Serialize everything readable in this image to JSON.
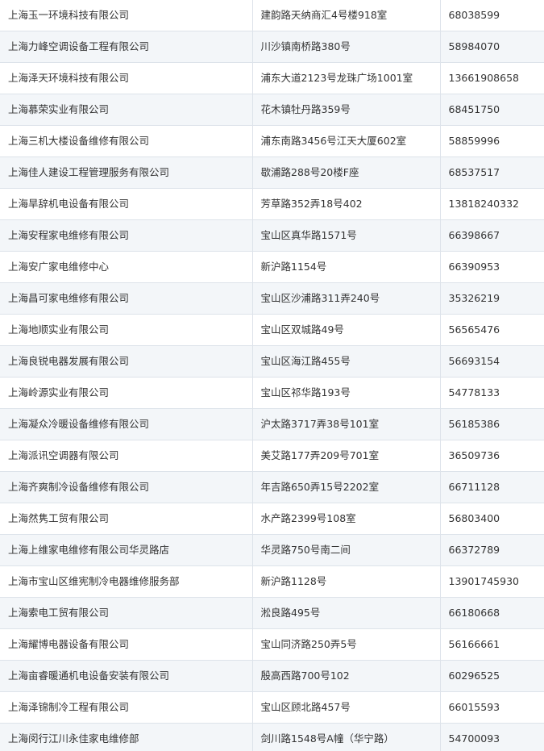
{
  "rows": [
    {
      "name": "上海玉一环境科技有限公司",
      "address": "建韵路天纳商汇4号楼918室",
      "phone": "68038599"
    },
    {
      "name": "上海力峰空调设备工程有限公司",
      "address": "川沙镇南桥路380号",
      "phone": "58984070"
    },
    {
      "name": "上海泽天环境科技有限公司",
      "address": "浦东大道2123号龙珠广场1001室",
      "phone": "13661908658"
    },
    {
      "name": "上海慕荣实业有限公司",
      "address": "花木镇牡丹路359号",
      "phone": "68451750"
    },
    {
      "name": "上海三机大楼设备维修有限公司",
      "address": "浦东南路3456号江天大厦602室",
      "phone": "58859996"
    },
    {
      "name": "上海佳人建设工程管理服务有限公司",
      "address": "歇浦路288号20楼F座",
      "phone": "68537517"
    },
    {
      "name": "上海旱辞机电设备有限公司",
      "address": "芳草路352弄18号402",
      "phone": "13818240332"
    },
    {
      "name": "上海安程家电维修有限公司",
      "address": "宝山区真华路1571号",
      "phone": "66398667"
    },
    {
      "name": "上海安广家电维修中心",
      "address": "新沪路1154号",
      "phone": "66390953"
    },
    {
      "name": "上海昌可家电维修有限公司",
      "address": "宝山区沙浦路311弄240号",
      "phone": "35326219"
    },
    {
      "name": "上海地顺实业有限公司",
      "address": "宝山区双城路49号",
      "phone": "56565476"
    },
    {
      "name": "上海良锐电器发展有限公司",
      "address": "宝山区海江路455号",
      "phone": "56693154"
    },
    {
      "name": "上海岭源实业有限公司",
      "address": "宝山区祁华路193号",
      "phone": "54778133"
    },
    {
      "name": "上海凝众冷暖设备维修有限公司",
      "address": "沪太路3717弄38号101室",
      "phone": "56185386"
    },
    {
      "name": "上海派讯空调器有限公司",
      "address": "美艾路177弄209号701室",
      "phone": "36509736"
    },
    {
      "name": "上海齐爽制冷设备维修有限公司",
      "address": "年吉路650弄15号2202室",
      "phone": "66711128"
    },
    {
      "name": "上海然隽工贸有限公司",
      "address": " 水产路2399号108室",
      "phone": "56803400"
    },
    {
      "name": "上海上维家电维修有限公司华灵路店",
      "address": "华灵路750号南二间",
      "phone": "66372789"
    },
    {
      "name": "上海市宝山区维宪制冷电器维修服务部",
      "address": "新沪路1128号",
      "phone": "13901745930"
    },
    {
      "name": "上海索电工贸有限公司",
      "address": "淞良路495号",
      "phone": "66180668"
    },
    {
      "name": "上海耀博电器设备有限公司",
      "address": "宝山同济路250弄5号",
      "phone": "56166661"
    },
    {
      "name": "上海亩睿暖通机电设备安装有限公司",
      "address": "殷高西路700号102",
      "phone": "60296525"
    },
    {
      "name": "上海泽锦制冷工程有限公司",
      "address": "宝山区顾北路457号",
      "phone": "66015593"
    },
    {
      "name": "上海闵行江川永佳家电维修部",
      "address": "剑川路1548号A幢（华宁路）",
      "phone": "54700093"
    }
  ]
}
